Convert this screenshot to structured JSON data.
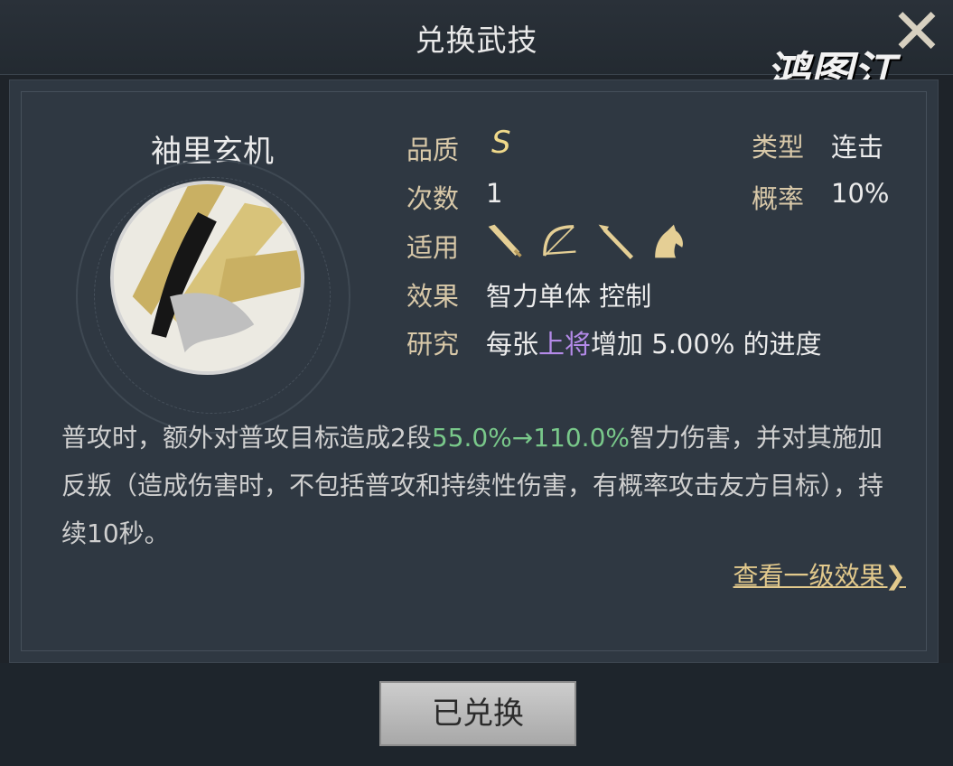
{
  "header": {
    "title": "兑换武技"
  },
  "logo": {
    "text": "鸿图江"
  },
  "skill": {
    "name": "袖里玄机",
    "quality_label": "品质",
    "quality_value": "S",
    "count_label": "次数",
    "count_value": "1",
    "applicable_label": "适用",
    "applicable_icons": [
      "blade-icon",
      "bow-icon",
      "spear-icon",
      "horse-icon"
    ],
    "effect_label": "效果",
    "effect_value": "智力单体 控制",
    "research_label": "研究",
    "research_prefix": "每张",
    "research_highlight": "上将",
    "research_suffix": "增加 5.00% 的进度",
    "type_label": "类型",
    "type_value": "连击",
    "rate_label": "概率",
    "rate_value": "10%"
  },
  "description": {
    "part1": "普攻时，额外对普攻目标造成2段",
    "highlight": "55.0%→110.0%",
    "part2": "智力伤害，并对其施加反叛（造成伤害时，不包括普攻和持续性伤害，有概率攻击友方目标），持续10秒。"
  },
  "links": {
    "view_level1": "查看一级效果❯"
  },
  "footer": {
    "button_label": "已兑换"
  },
  "colors": {
    "accent_gold": "#e2c98c",
    "highlight_green": "#79c88a",
    "highlight_purple": "#b48ae8"
  }
}
